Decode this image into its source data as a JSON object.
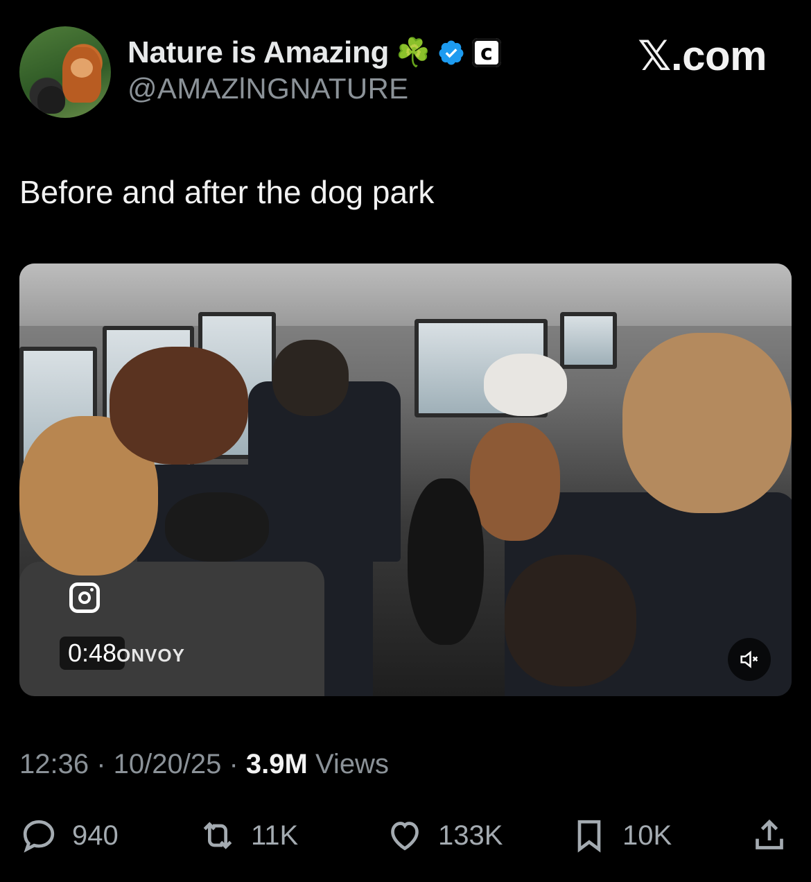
{
  "author": {
    "display_name": "Nature is Amazing",
    "emoji": "☘️",
    "affiliate_badge": "c",
    "handle": "@AMAZlNGNATURE"
  },
  "site_label": "𝕏.com",
  "tweet": {
    "text": "Before and after the dog park"
  },
  "media": {
    "duration": "0:48",
    "watermark": "ONVOY",
    "muted": true
  },
  "meta": {
    "time": "12:36",
    "separator": " · ",
    "date": "10/20/25",
    "views_count": "3.9M",
    "views_label": "Views"
  },
  "actions": {
    "replies": "940",
    "reposts": "11K",
    "likes": "133K",
    "bookmarks": "10K"
  },
  "colors": {
    "background": "#000000",
    "verified_blue": "#1d9bf0",
    "muted_text": "#8b9298"
  },
  "icons": [
    "clover-emoji",
    "verified-icon",
    "affiliate-badge-icon",
    "instagram-icon",
    "mute-icon",
    "reply-icon",
    "repost-icon",
    "like-icon",
    "bookmark-icon",
    "share-icon"
  ]
}
